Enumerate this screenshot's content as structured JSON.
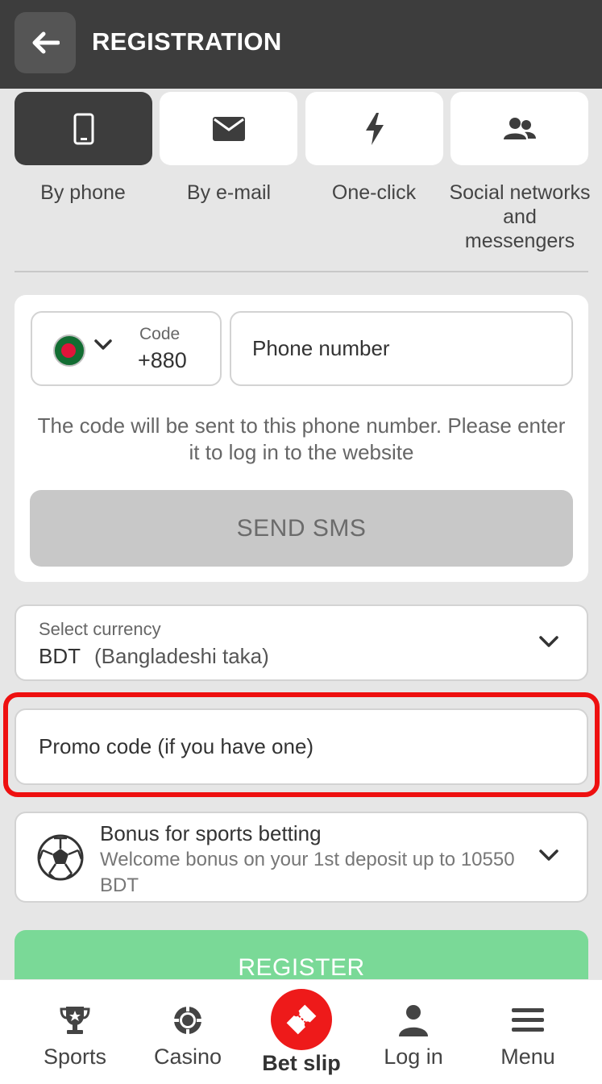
{
  "header": {
    "title": "REGISTRATION"
  },
  "tabs": [
    {
      "label": "By phone",
      "icon": "phone-icon",
      "active": true
    },
    {
      "label": "By e-mail",
      "icon": "mail-icon",
      "active": false
    },
    {
      "label": "One-click",
      "icon": "lightning-icon",
      "active": false
    },
    {
      "label": "Social networks and messengers",
      "icon": "users-icon",
      "active": false
    }
  ],
  "phone_form": {
    "code_label": "Code",
    "code_value": "+880",
    "phone_placeholder": "Phone number",
    "hint": "The code will be sent to this phone number. Please enter it to log in to the website",
    "send_label": "SEND SMS"
  },
  "currency": {
    "label": "Select currency",
    "code": "BDT",
    "name": "(Bangladeshi taka)"
  },
  "promo": {
    "placeholder": "Promo code (if you have one)"
  },
  "bonus": {
    "title": "Bonus for sports betting",
    "description": "Welcome bonus on your 1st deposit up to 10550 BDT"
  },
  "register_label": "REGISTER",
  "nav": {
    "sports": "Sports",
    "casino": "Casino",
    "bet_slip": "Bet slip",
    "login": "Log in",
    "menu": "Menu"
  },
  "colors": {
    "header_bg": "#3d3d3d",
    "register_green": "#7ad997",
    "highlight_red": "#ee1010",
    "betslip_red": "#ee1a1a"
  }
}
